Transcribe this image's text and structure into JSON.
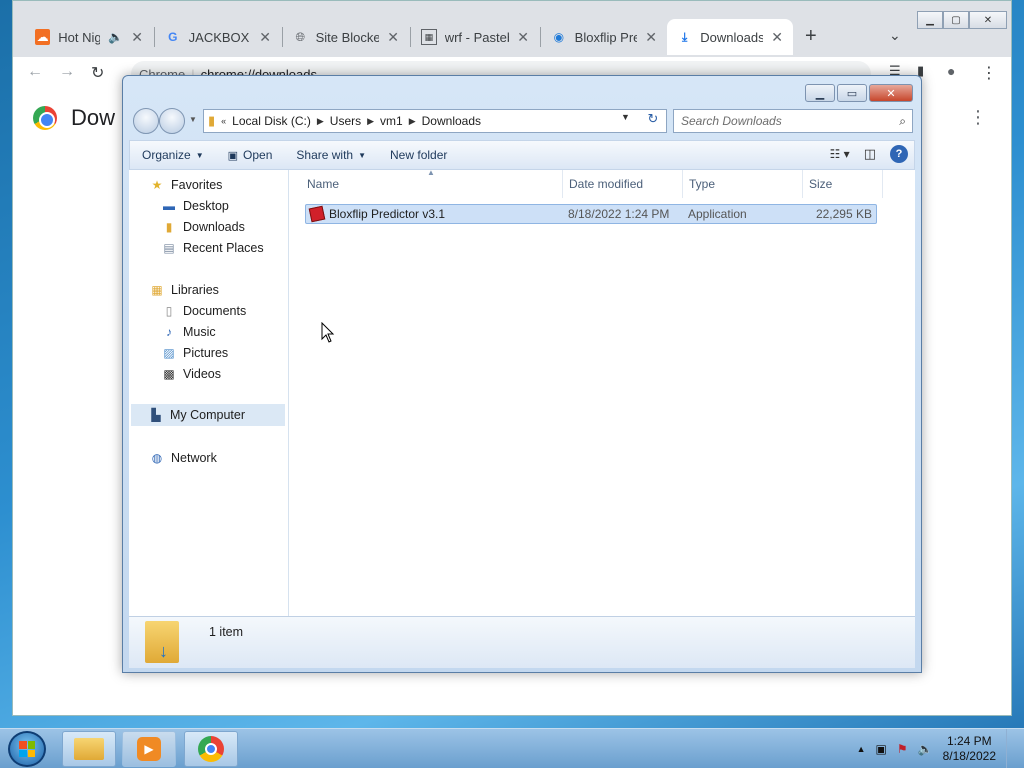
{
  "chrome": {
    "tabs": [
      {
        "label": "Hot Nig",
        "icon": "soundcloud-icon"
      },
      {
        "label": "JACKBOX P",
        "icon": "google-icon"
      },
      {
        "label": "Site Blocked",
        "icon": "globe-icon"
      },
      {
        "label": "wrf - Pasteb",
        "icon": "pastebin-icon"
      },
      {
        "label": "Bloxflip Pre",
        "icon": "bloxflip-icon"
      },
      {
        "label": "Downloads",
        "icon": "download-icon"
      }
    ],
    "omnibox_chip": "Chrome",
    "omnibox_url": "chrome://downloads",
    "page_title": "Dow"
  },
  "explorer": {
    "breadcrumbs": [
      "Local Disk (C:)",
      "Users",
      "vm1",
      "Downloads"
    ],
    "search_placeholder": "Search Downloads",
    "commands": {
      "organize": "Organize",
      "open": "Open",
      "share_with": "Share with",
      "new_folder": "New folder"
    },
    "nav": {
      "favorites": "Favorites",
      "desktop": "Desktop",
      "downloads": "Downloads",
      "recent_places": "Recent Places",
      "libraries": "Libraries",
      "documents": "Documents",
      "music": "Music",
      "pictures": "Pictures",
      "videos": "Videos",
      "my_computer": "My Computer",
      "network": "Network"
    },
    "columns": {
      "name": "Name",
      "date_modified": "Date modified",
      "type": "Type",
      "size": "Size"
    },
    "files": [
      {
        "name": "Bloxflip Predictor v3.1",
        "date": "8/18/2022 1:24 PM",
        "type": "Application",
        "size": "22,295 KB"
      }
    ],
    "item_count": "1 item"
  },
  "taskbar": {
    "time": "1:24 PM",
    "date": "8/18/2022"
  },
  "colors": {
    "selection": "#cde0f7",
    "accent": "#2f66b5"
  }
}
